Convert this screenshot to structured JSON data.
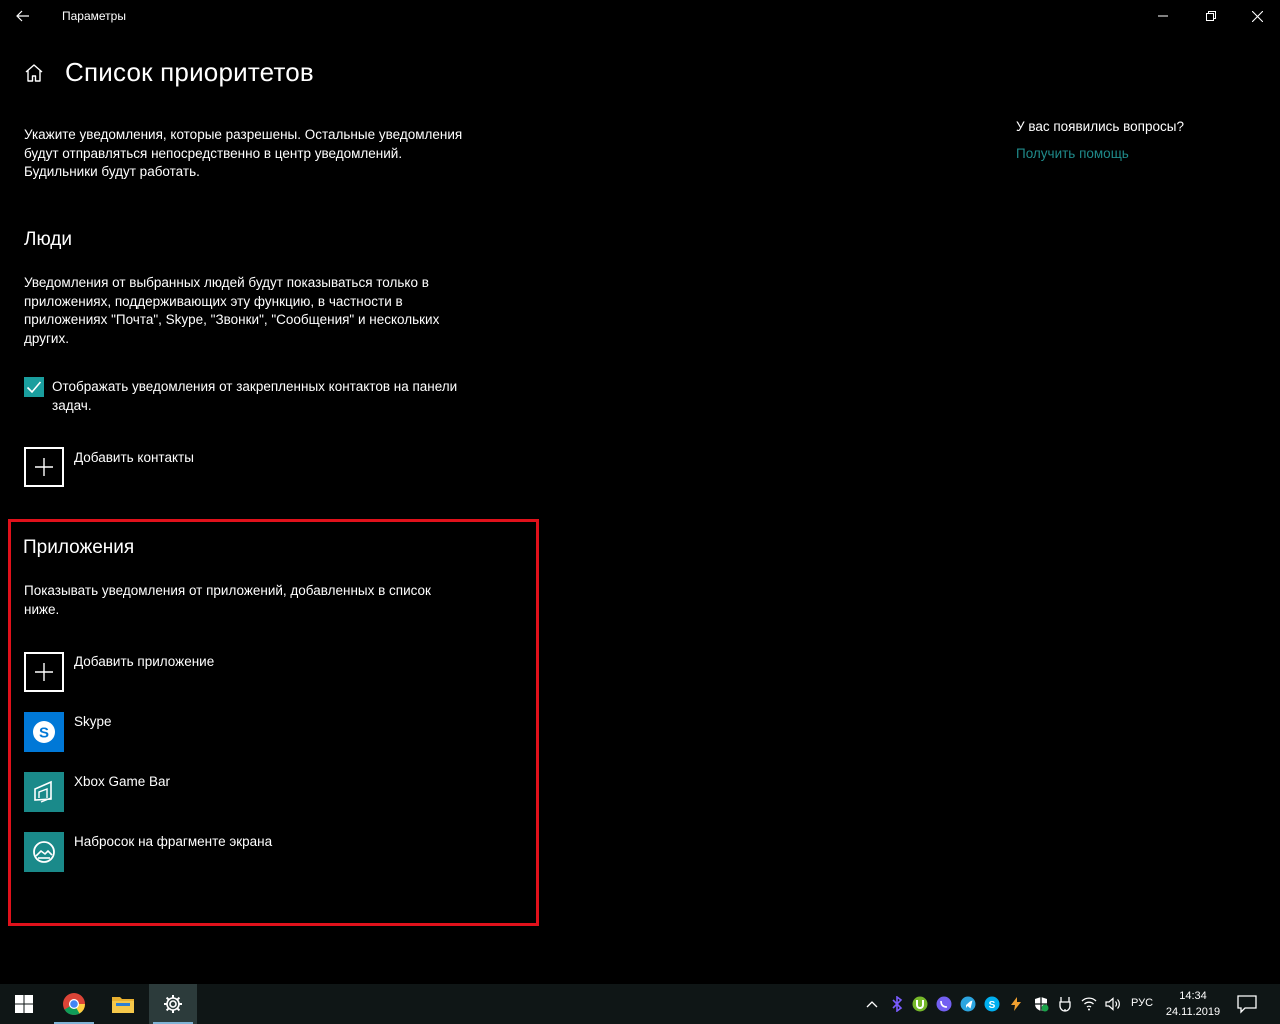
{
  "window": {
    "app_title": "Параметры",
    "back_icon": "back-arrow-icon",
    "minimize_icon": "minimize-icon",
    "restore_icon": "restore-icon",
    "close_icon": "close-icon"
  },
  "header": {
    "home_icon": "home-icon",
    "title": "Список приоритетов"
  },
  "intro": {
    "lines": [
      "Укажите уведомления, которые разрешены. Остальные уведомления",
      "будут отправляться непосредственно в центр уведомлений.",
      "Будильники будут работать."
    ]
  },
  "people": {
    "title": "Люди",
    "description_lines": [
      "Уведомления от выбранных людей будут показываться только в",
      "приложениях, поддерживающих эту функцию, в частности в",
      "приложениях \"Почта\", Skype, \"Звонки\", \"Сообщения\" и нескольких",
      "других."
    ],
    "checkbox_checked": true,
    "checkbox_lines": [
      "Отображать уведомления от закрепленных контактов на панели",
      "задач."
    ],
    "add_contacts_label": "Добавить контакты"
  },
  "apps": {
    "title": "Приложения",
    "description_lines": [
      "Показывать уведомления от приложений, добавленных в список",
      "ниже."
    ],
    "add_app_label": "Добавить приложение",
    "items": [
      {
        "name": "Skype",
        "icon": "skype-icon",
        "color": "#0078d7"
      },
      {
        "name": "Xbox Game Bar",
        "icon": "xbox-game-bar-icon",
        "color": "#1a8a8a"
      },
      {
        "name": "Набросок на фрагменте экрана",
        "icon": "snip-sketch-icon",
        "color": "#1a8a8a"
      }
    ]
  },
  "help": {
    "question": "У вас появились вопросы?",
    "link": "Получить помощь"
  },
  "colors": {
    "accent": "#1a9e9e",
    "highlight_border": "#e0111b",
    "link": "#1f8a8a",
    "background": "#000000"
  },
  "taskbar": {
    "start_icon": "windows-start-icon",
    "pinned": [
      "chrome-icon",
      "file-explorer-icon",
      "settings-gear-icon"
    ],
    "active": "settings-gear-icon",
    "tray_icons": [
      "chevron-up-icon",
      "bluetooth-icon",
      "utorrent-icon",
      "viber-icon",
      "telegram-icon",
      "skype-tray-icon",
      "power-icon",
      "defender-icon",
      "usb-icon",
      "network-icon",
      "volume-icon"
    ],
    "language": "РУС",
    "time": "14:34",
    "date": "24.11.2019",
    "notification_icon": "action-center-icon"
  }
}
